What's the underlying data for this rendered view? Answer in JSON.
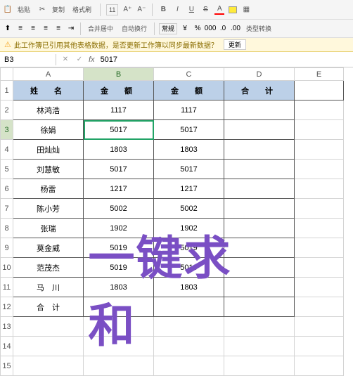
{
  "toolbar": {
    "paste_label": "粘贴",
    "copy_label": "复制",
    "format_brush": "格式刷",
    "font_size": "11",
    "bold": "B",
    "italic": "I",
    "underline": "U",
    "strike": "S",
    "font_color": "A",
    "merge_label": "合并居中",
    "wrap_label": "自动换行",
    "format_label": "常规",
    "percent": "%",
    "comma": "000",
    "decimal_inc": ".0",
    "decimal_dec": ".00",
    "type_convert": "类型转换"
  },
  "warning": {
    "text": "此工作簿已引用其他表格数据，是否更新工作簿以同步最新数据？",
    "update_btn": "更新"
  },
  "formula_bar": {
    "cell_ref": "B3",
    "fx": "fx",
    "value": "5017"
  },
  "columns": [
    "A",
    "B",
    "C",
    "D",
    "E"
  ],
  "rows_numbers": [
    "1",
    "2",
    "3",
    "4",
    "5",
    "6",
    "7",
    "8",
    "9",
    "10",
    "11",
    "12",
    "13",
    "14",
    "15"
  ],
  "headers": {
    "name": "姓　名",
    "amount1": "金　额",
    "amount2": "金　额",
    "total": "合　计"
  },
  "data_rows": [
    {
      "name": "林鸿浩",
      "b": "1117",
      "c": "1117",
      "d": ""
    },
    {
      "name": "徐娟",
      "b": "5017",
      "c": "5017",
      "d": ""
    },
    {
      "name": "田灿灿",
      "b": "1803",
      "c": "1803",
      "d": ""
    },
    {
      "name": "刘慧敏",
      "b": "5017",
      "c": "5017",
      "d": ""
    },
    {
      "name": "杨雷",
      "b": "1217",
      "c": "1217",
      "d": ""
    },
    {
      "name": "陈小芳",
      "b": "5002",
      "c": "5002",
      "d": ""
    },
    {
      "name": "张瑞",
      "b": "1902",
      "c": "1902",
      "d": ""
    },
    {
      "name": "莫金威",
      "b": "5019",
      "c": "5019",
      "d": ""
    },
    {
      "name": "范茂杰",
      "b": "5019",
      "c": "5019",
      "d": ""
    },
    {
      "name": "马　川",
      "b": "1803",
      "c": "1803",
      "d": ""
    }
  ],
  "total_row": {
    "label": "合　计",
    "b": "",
    "c": "",
    "d": ""
  },
  "overlay": "一键求和",
  "active": {
    "row": 3,
    "col": "B"
  },
  "chart_data": {
    "type": "table",
    "title": "",
    "columns": [
      "姓名",
      "金额",
      "金额",
      "合计"
    ],
    "rows": [
      [
        "林鸿浩",
        1117,
        1117,
        null
      ],
      [
        "徐娟",
        5017,
        5017,
        null
      ],
      [
        "田灿灿",
        1803,
        1803,
        null
      ],
      [
        "刘慧敏",
        5017,
        5017,
        null
      ],
      [
        "杨雷",
        1217,
        1217,
        null
      ],
      [
        "陈小芳",
        5002,
        5002,
        null
      ],
      [
        "张瑞",
        1902,
        1902,
        null
      ],
      [
        "莫金威",
        5019,
        5019,
        null
      ],
      [
        "范茂杰",
        5019,
        5019,
        null
      ],
      [
        "马川",
        1803,
        1803,
        null
      ],
      [
        "合计",
        null,
        null,
        null
      ]
    ]
  }
}
